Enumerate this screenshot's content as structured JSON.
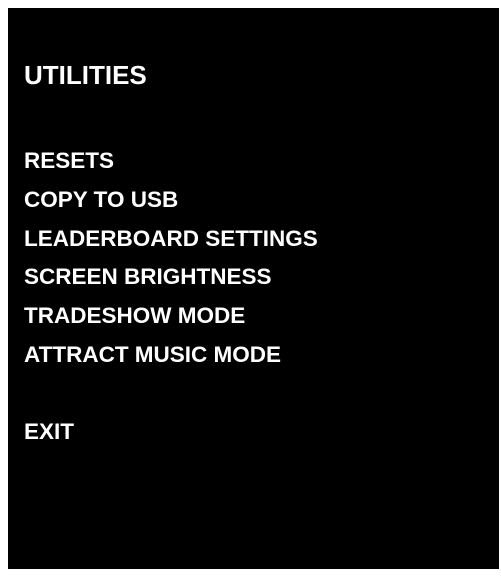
{
  "screen": {
    "title": "UTILITIES",
    "background_color": "#000000",
    "text_color": "#ffffff"
  },
  "menu": {
    "items": [
      {
        "label": "RESETS"
      },
      {
        "label": "COPY TO USB"
      },
      {
        "label": "LEADERBOARD SETTINGS"
      },
      {
        "label": "SCREEN BRIGHTNESS"
      },
      {
        "label": "TRADESHOW MODE"
      },
      {
        "label": "ATTRACT MUSIC MODE"
      }
    ],
    "exit_label": "EXIT"
  }
}
